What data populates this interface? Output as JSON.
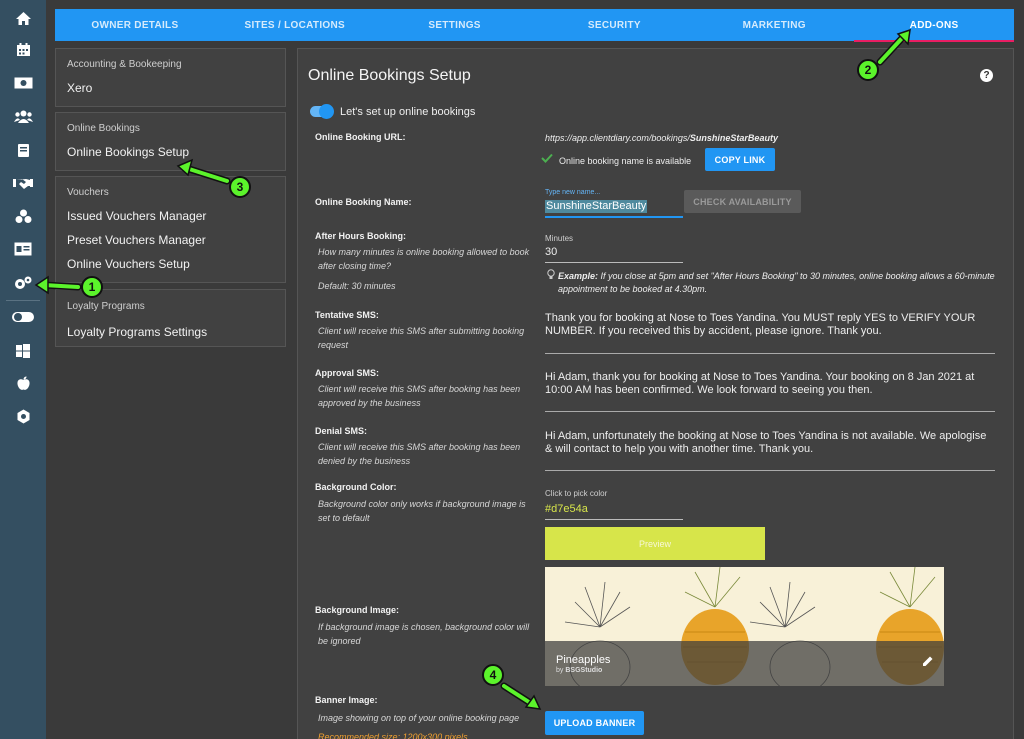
{
  "rail": {
    "icons": [
      "home-icon",
      "calendar-icon",
      "cash-icon",
      "users-icon",
      "book-icon",
      "handshake-icon",
      "boxes-icon",
      "id-card-icon",
      "gears-icon",
      "toggle-icon",
      "windows-icon",
      "apple-icon",
      "settings-icon"
    ]
  },
  "tabs": [
    {
      "label": "OWNER DETAILS"
    },
    {
      "label": "SITES / LOCATIONS"
    },
    {
      "label": "SETTINGS"
    },
    {
      "label": "SECURITY"
    },
    {
      "label": "MARKETING"
    },
    {
      "label": "ADD-ONS"
    }
  ],
  "sidebar": {
    "accounting": {
      "header": "Accounting & Bookeeping",
      "items": [
        "Xero"
      ]
    },
    "bookings": {
      "header": "Online Bookings",
      "items": [
        "Online Bookings Setup"
      ]
    },
    "vouchers": {
      "header": "Vouchers",
      "items": [
        "Issued Vouchers Manager",
        "Preset Vouchers Manager",
        "Online Vouchers Setup"
      ]
    },
    "loyalty": {
      "header": "Loyalty Programs",
      "items": [
        "Loyalty Programs Settings"
      ]
    }
  },
  "main": {
    "title": "Online Bookings Setup",
    "help": "?",
    "toggle_label": "Let's set up online bookings",
    "url": {
      "label": "Online Booking URL:",
      "prefix": "https://app.clientdiary.com/bookings/",
      "name": "SunshineStarBeauty",
      "available": "Online booking name is available",
      "copy": "COPY LINK"
    },
    "name": {
      "label": "Online Booking Name:",
      "placeholder": "Type new name...",
      "value": "SunshineStarBeauty",
      "check": "CHECK AVAILABILITY"
    },
    "after": {
      "label": "After Hours Booking:",
      "desc": "How many minutes is online booking allowed to book after closing time?",
      "default": "Default: 30 minutes",
      "field_label": "Minutes",
      "value": "30",
      "example_label": "Example:",
      "example": "If you close at 5pm and set \"After Hours Booking\" to 30 minutes, online booking allows a 60-minute appointment to be booked at 4.30pm."
    },
    "tentative": {
      "label": "Tentative SMS:",
      "desc": "Client will receive this SMS after submitting booking request",
      "value": "Thank you for booking at Nose to Toes Yandina. You MUST reply YES to VERIFY YOUR NUMBER. If you received this by accident, please ignore. Thank you."
    },
    "approval": {
      "label": "Approval SMS:",
      "desc": "Client will receive this SMS after booking has been approved by the business",
      "value": "Hi Adam, thank you for booking at Nose to Toes Yandina. Your booking on 8 Jan 2021 at 10:00 AM has been confirmed. We look forward to seeing you then."
    },
    "denial": {
      "label": "Denial SMS:",
      "desc": "Client will receive this SMS after booking has been denied by the business",
      "value": "Hi Adam, unfortunately the booking at Nose to Toes Yandina is not available. We apologise & will contact to help you with another time. Thank you."
    },
    "bgcolor": {
      "label": "Background Color:",
      "desc": "Background color only works if background image is set to default",
      "field_label": "Click to pick color",
      "value": "#d7e54a",
      "preview": "Preview",
      "color": "#d7e54a"
    },
    "bgimage": {
      "label": "Background Image:",
      "desc": "If background image is chosen, background color will be ignored",
      "title": "Pineapples",
      "by": "by",
      "author": "BSGStudio"
    },
    "banner": {
      "label": "Banner Image:",
      "desc": "Image showing on top of your online booking page",
      "recommend": "Recommended size: 1200x300 pixels",
      "upload": "UPLOAD BANNER"
    }
  },
  "annotations": [
    "1",
    "2",
    "3",
    "4"
  ]
}
